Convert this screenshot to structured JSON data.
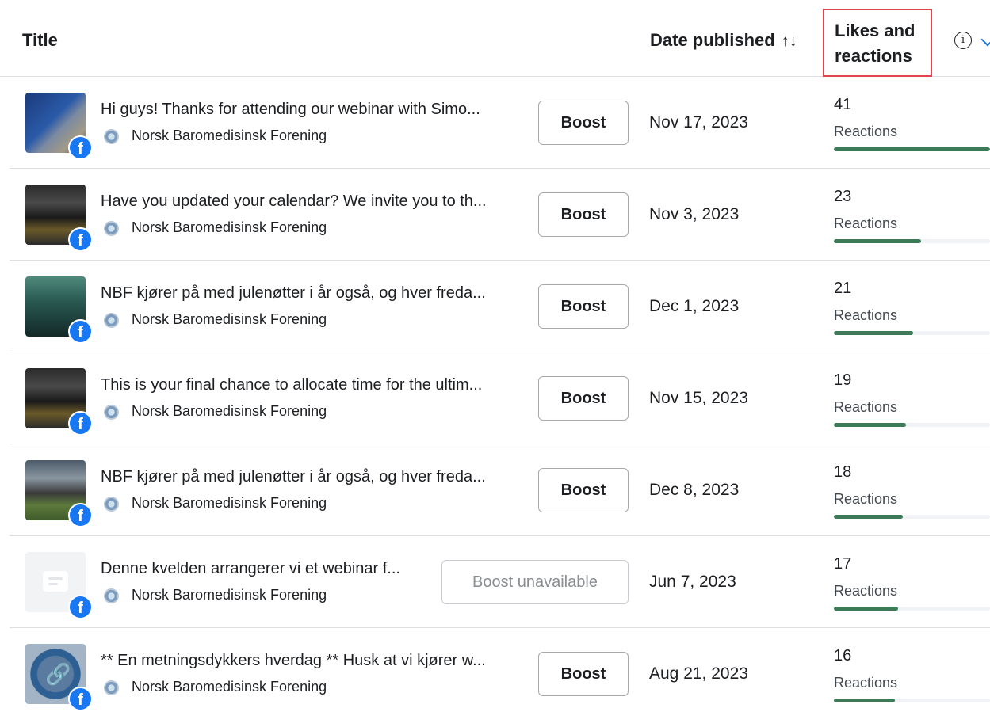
{
  "header": {
    "title_label": "Title",
    "date_label": "Date published",
    "sort_icon": "↑↓",
    "likes_line1": "Likes and",
    "likes_line2": "reactions",
    "info_icon": "i"
  },
  "page_name": "Norsk Baromedisinsk Forening",
  "reactions_label": "Reactions",
  "bar_color": "#3d7b58",
  "rows": [
    {
      "thumb": "webinar-thumbnail",
      "text": "Hi guys! Thanks for attending our webinar with Simo...",
      "boost": "Boost",
      "boost_enabled": true,
      "date": "Nov 17, 2023",
      "count": "41",
      "fraction": 1.0
    },
    {
      "thumb": "divers-thumbnail",
      "text": "Have you updated your calendar? We invite you to th...",
      "boost": "Boost",
      "boost_enabled": true,
      "date": "Nov 3, 2023",
      "count": "23",
      "fraction": 0.56
    },
    {
      "thumb": "wreck-thumbnail",
      "text": "NBF kjører på med julenøtter i år også, og hver freda...",
      "boost": "Boost",
      "boost_enabled": true,
      "date": "Dec 1, 2023",
      "count": "21",
      "fraction": 0.51
    },
    {
      "thumb": "divers-thumbnail",
      "text": "This is your final chance to allocate time for the ultim...",
      "boost": "Boost",
      "boost_enabled": true,
      "date": "Nov 15, 2023",
      "count": "19",
      "fraction": 0.46
    },
    {
      "thumb": "field-thumbnail",
      "text": "NBF kjører på med julenøtter i år også, og hver freda...",
      "boost": "Boost",
      "boost_enabled": true,
      "date": "Dec 8, 2023",
      "count": "18",
      "fraction": 0.44
    },
    {
      "thumb": "placeholder-thumbnail",
      "text": "Denne kvelden arrangerer vi et webinar f...",
      "boost": "Boost unavailable",
      "boost_enabled": false,
      "date": "Jun 7, 2023",
      "count": "17",
      "fraction": 0.41
    },
    {
      "thumb": "link-thumbnail",
      "text": "** En metningsdykkers hverdag ** Husk at vi kjører w...",
      "boost": "Boost",
      "boost_enabled": true,
      "date": "Aug 21, 2023",
      "count": "16",
      "fraction": 0.39
    }
  ]
}
